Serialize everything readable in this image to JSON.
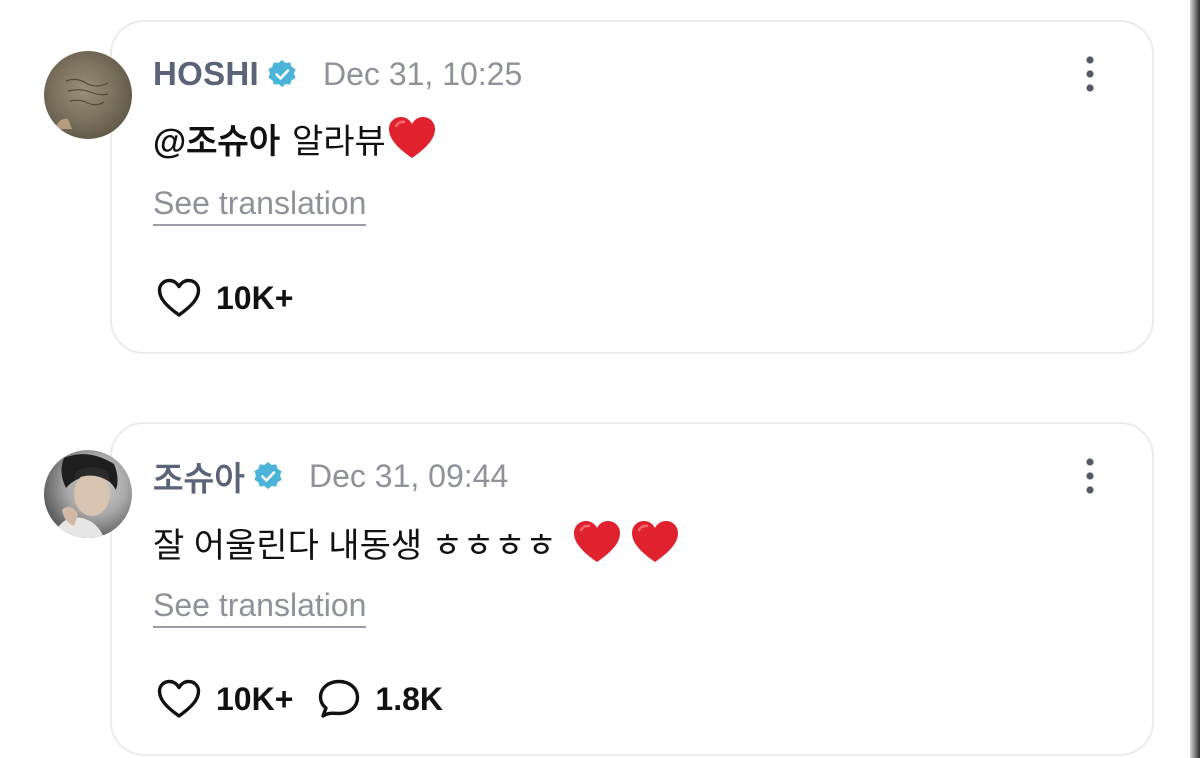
{
  "comments": [
    {
      "username": "HOSHI",
      "timestamp": "Dec 31, 10:25",
      "mention": "@조슈아",
      "text": "알라뷰",
      "emoji": [
        "red-heart"
      ],
      "translate_label": "See translation",
      "likes": "10K+"
    },
    {
      "username": "조슈아",
      "timestamp": "Dec 31, 09:44",
      "text": "잘 어울린다 내동생 ㅎㅎㅎㅎ",
      "emoji": [
        "red-heart",
        "red-heart"
      ],
      "translate_label": "See translation",
      "likes": "10K+",
      "replies": "1.8K"
    }
  ],
  "colors": {
    "username": "#5b6379",
    "timestamp": "#8f929b",
    "verified": "#4cb4d8",
    "heart_emoji": "#e0222e",
    "card_border": "#ebebeb"
  },
  "icons": {
    "verified": "verified-badge-icon",
    "more": "more-vertical-icon",
    "like": "heart-outline-icon",
    "reply": "speech-bubble-icon"
  }
}
